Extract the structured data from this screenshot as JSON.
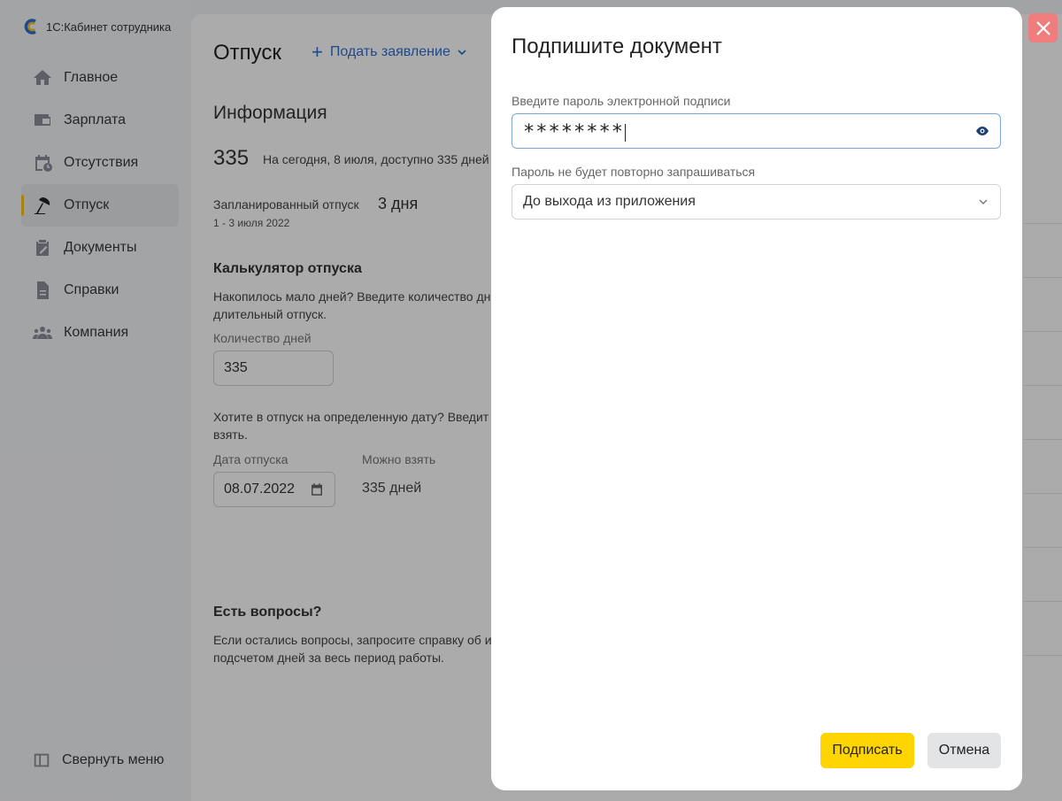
{
  "app": {
    "brand": "1С:Кабинет сотрудника"
  },
  "sidebar": {
    "items": [
      {
        "label": "Главное",
        "icon": "home-icon"
      },
      {
        "label": "Зарплата",
        "icon": "wallet-icon"
      },
      {
        "label": "Отсутствия",
        "icon": "calendar-clock-icon"
      },
      {
        "label": "Отпуск",
        "icon": "beach-umbrella-icon",
        "active": true
      },
      {
        "label": "Документы",
        "icon": "clipboard-icon"
      },
      {
        "label": "Справки",
        "icon": "document-icon"
      },
      {
        "label": "Компания",
        "icon": "people-icon"
      }
    ],
    "collapse_label": "Свернуть меню"
  },
  "main": {
    "title": "Отпуск",
    "apply_label": "Подать заявление",
    "info_title": "Информация",
    "days_available": "335",
    "days_note": "На сегодня, 8 июля, доступно 335 дней",
    "planned_label": "Запланированный отпуск",
    "planned_value": "3 дня",
    "planned_dates": "1 - 3 июля 2022",
    "calc_title": "Калькулятор отпуска",
    "calc_desc": "Накопилось мало дней? Введите количество дн длительный отпуск.",
    "days_field_label": "Количество дней",
    "days_field_value": "335",
    "date_desc": "Хотите в отпуск на определенную дату? Введит взять.",
    "date_field_label": "Дата отпуска",
    "date_field_value": "08.07.2022",
    "can_take_label": "Можно взять",
    "can_take_value": "335 дней",
    "questions_title": "Есть вопросы?",
    "questions_desc": "Если остались вопросы, запросите справку об и подсчетом дней за весь период работы."
  },
  "dialog": {
    "title": "Подпишите документ",
    "password_label": "Введите пароль электронной подписи",
    "password_value": "********",
    "remember_label": "Пароль не будет повторно запрашиваться",
    "remember_value": "До выхода из приложения",
    "sign_label": "Подписать",
    "cancel_label": "Отмена"
  },
  "colors": {
    "accent": "#ffd500",
    "link": "#2d6fd1",
    "close": "#f07d7d",
    "active_marker": "#f5c518"
  }
}
